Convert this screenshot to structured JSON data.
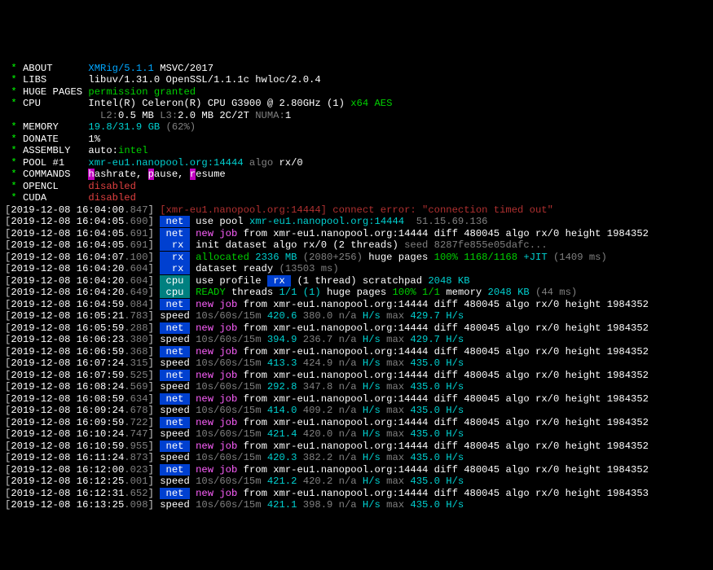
{
  "header": {
    "about": {
      "label": "ABOUT",
      "app": "XMRig/5.1.1",
      "compiler": " MSVC/2017"
    },
    "libs": {
      "label": "LIBS",
      "value": "libuv/1.31.0 OpenSSL/1.1.1c hwloc/2.0.4"
    },
    "huge_pages": {
      "label": "HUGE PAGES",
      "value": "permission granted"
    },
    "cpu": {
      "label": "CPU",
      "name": "Intel(R) Celeron(R) CPU G3900 @ 2.80GHz (1) ",
      "flags": "x64 AES",
      "l2l": "L2:",
      "l2": "0.5 MB",
      "l3l": " L3:",
      "l3": "2.0 MB",
      "core": " 2C/2T",
      "numa": " NUMA:",
      "numav": "1"
    },
    "memory": {
      "label": "MEMORY",
      "value": "19.8/31.9 ",
      "unit": "GB ",
      "pct": "(62%)"
    },
    "donate": {
      "label": "DONATE",
      "value": "1%"
    },
    "assembly": {
      "label": "ASSEMBLY",
      "auto": "auto:",
      "intel": "intel"
    },
    "pool": {
      "label": "POOL #1",
      "value": "xmr-eu1.nanopool.org:14444",
      "algo_l": " algo ",
      "algo": "rx/0"
    },
    "commands": {
      "label": "COMMANDS",
      "h": "h",
      "hr": "ashrate, ",
      "p": "p",
      "pa": "ause, ",
      "r": "r",
      "re": "esume"
    },
    "opencl": {
      "label": "OPENCL",
      "value": "disabled"
    },
    "cuda": {
      "label": "CUDA",
      "value": "disabled"
    }
  },
  "log": [
    {
      "ts": "2019-12-08 16:04:00",
      "ms": ".847",
      "tag": "",
      "txt_red": "[xmr-eu1.nanopool.org:14444] connect error: \"connection timed out\""
    },
    {
      "ts": "2019-12-08 16:04:05",
      "ms": ".690",
      "tag": "net",
      "a": "use pool ",
      "pool": "xmr-eu1.nanopool.org:14444",
      "ip": "  51.15.69.136"
    },
    {
      "ts": "2019-12-08 16:04:05",
      "ms": ".691",
      "tag": "net",
      "a": "new job",
      "b": " from xmr-eu1.nanopool.org:14444 diff ",
      "diff": "480045",
      "c": " algo ",
      "algo": "rx/0",
      "d": " height ",
      "h": "1984352"
    },
    {
      "ts": "2019-12-08 16:04:05",
      "ms": ".691",
      "tag": "rx",
      "a2": "init dataset",
      " b": " algo ",
      "algo": "rx/0",
      "thr": " (2 threads)",
      "seed": " seed 8287fe855e05dafc..."
    },
    {
      "ts": "2019-12-08 16:04:07",
      "ms": ".100",
      "tag": "rx",
      "a2": "allocated",
      "mb": " 2336 MB",
      "g": " (2080+256) ",
      "hp": "huge pages ",
      "ok": "100% 1168/1168",
      "jit": " +JIT",
      "e": " (1409 ms)"
    },
    {
      "ts": "2019-12-08 16:04:20",
      "ms": ".604",
      "tag": "rx",
      "a2": "dataset ready",
      "g2": " (13503 ms)"
    },
    {
      "ts": "2019-12-08 16:04:20",
      "ms": ".604",
      "tag": "cpu",
      "a": "use profile ",
      " prof": " rx ",
      "thr2": " (1 thread)",
      "sp": " scratchpad ",
      "spv": "2048 KB"
    },
    {
      "ts": "2019-12-08 16:04:20",
      "ms": ".649",
      "tag": "cpu",
      "rdy": "READY ",
      "rt": "threads ",
      "tok": "1/1 (1)",
      "hp2": " huge pages ",
      "ok2": "100% 1/1",
      "mem": " memory ",
      "memv": "2048 KB",
      "g3": " (44 ms)"
    },
    {
      "ts": "2019-12-08 16:04:59",
      "ms": ".084",
      "tag": "net",
      "a": "new job",
      "b": " from xmr-eu1.nanopool.org:14444 diff ",
      "diff": "480045",
      "c": " algo ",
      "algo": "rx/0",
      "d": " height ",
      "h": "1984352"
    },
    {
      "ts": "2019-12-08 16:05:21",
      "ms": ".783",
      "tag": "",
      "spd": "speed",
      "sl": " 10s/60s/15m ",
      "v1": "420.6 ",
      "v2": "380.0 ",
      "v3": "n/a ",
      "hs": "H/s ",
      "mx": "max ",
      "mv": "429.7 H/s"
    },
    {
      "ts": "2019-12-08 16:05:59",
      "ms": ".288",
      "tag": "net",
      "a": "new job",
      "b": " from xmr-eu1.nanopool.org:14444 diff ",
      "diff": "480045",
      "c": " algo ",
      "algo": "rx/0",
      "d": " height ",
      "h": "1984352"
    },
    {
      "ts": "2019-12-08 16:06:23",
      "ms": ".380",
      "tag": "",
      "spd": "speed",
      "sl": " 10s/60s/15m ",
      "v1": "394.9 ",
      "v2": "236.7 ",
      "v3": "n/a ",
      "hs": "H/s ",
      "mx": "max ",
      "mv": "429.7 H/s"
    },
    {
      "ts": "2019-12-08 16:06:59",
      "ms": ".368",
      "tag": "net",
      "a": "new job",
      "b": " from xmr-eu1.nanopool.org:14444 diff ",
      "diff": "480045",
      "c": " algo ",
      "algo": "rx/0",
      "d": " height ",
      "h": "1984352"
    },
    {
      "ts": "2019-12-08 16:07:24",
      "ms": ".315",
      "tag": "",
      "spd": "speed",
      "sl": " 10s/60s/15m ",
      "v1": "413.3 ",
      "v2": "424.9 ",
      "v3": "n/a ",
      "hs": "H/s ",
      "mx": "max ",
      "mv": "435.0 H/s"
    },
    {
      "ts": "2019-12-08 16:07:59",
      "ms": ".525",
      "tag": "net",
      "a": "new job",
      "b": " from xmr-eu1.nanopool.org:14444 diff ",
      "diff": "480045",
      "c": " algo ",
      "algo": "rx/0",
      "d": " height ",
      "h": "1984352"
    },
    {
      "ts": "2019-12-08 16:08:24",
      "ms": ".569",
      "tag": "",
      "spd": "speed",
      "sl": " 10s/60s/15m ",
      "v1": "292.8 ",
      "v2": "347.8 ",
      "v3": "n/a ",
      "hs": "H/s ",
      "mx": "max ",
      "mv": "435.0 H/s"
    },
    {
      "ts": "2019-12-08 16:08:59",
      "ms": ".634",
      "tag": "net",
      "a": "new job",
      "b": " from xmr-eu1.nanopool.org:14444 diff ",
      "diff": "480045",
      "c": " algo ",
      "algo": "rx/0",
      "d": " height ",
      "h": "1984352"
    },
    {
      "ts": "2019-12-08 16:09:24",
      "ms": ".678",
      "tag": "",
      "spd": "speed",
      "sl": " 10s/60s/15m ",
      "v1": "414.0 ",
      "v2": "409.2 ",
      "v3": "n/a ",
      "hs": "H/s ",
      "mx": "max ",
      "mv": "435.0 H/s"
    },
    {
      "ts": "2019-12-08 16:09:59",
      "ms": ".722",
      "tag": "net",
      "a": "new job",
      "b": " from xmr-eu1.nanopool.org:14444 diff ",
      "diff": "480045",
      "c": " algo ",
      "algo": "rx/0",
      "d": " height ",
      "h": "1984352"
    },
    {
      "ts": "2019-12-08 16:10:24",
      "ms": ".747",
      "tag": "",
      "spd": "speed",
      "sl": " 10s/60s/15m ",
      "v1": "421.4 ",
      "v2": "420.0 ",
      "v3": "n/a ",
      "hs": "H/s ",
      "mx": "max ",
      "mv": "435.0 H/s"
    },
    {
      "ts": "2019-12-08 16:10:59",
      "ms": ".955",
      "tag": "net",
      "a": "new job",
      "b": " from xmr-eu1.nanopool.org:14444 diff ",
      "diff": "480045",
      "c": " algo ",
      "algo": "rx/0",
      "d": " height ",
      "h": "1984352"
    },
    {
      "ts": "2019-12-08 16:11:24",
      "ms": ".873",
      "tag": "",
      "spd": "speed",
      "sl": " 10s/60s/15m ",
      "v1": "420.3 ",
      "v2": "382.2 ",
      "v3": "n/a ",
      "hs": "H/s ",
      "mx": "max ",
      "mv": "435.0 H/s"
    },
    {
      "ts": "2019-12-08 16:12:00",
      "ms": ".023",
      "tag": "net",
      "a": "new job",
      "b": " from xmr-eu1.nanopool.org:14444 diff ",
      "diff": "480045",
      "c": " algo ",
      "algo": "rx/0",
      "d": " height ",
      "h": "1984352"
    },
    {
      "ts": "2019-12-08 16:12:25",
      "ms": ".001",
      "tag": "",
      "spd": "speed",
      "sl": " 10s/60s/15m ",
      "v1": "421.2 ",
      "v2": "420.2 ",
      "v3": "n/a ",
      "hs": "H/s ",
      "mx": "max ",
      "mv": "435.0 H/s"
    },
    {
      "ts": "2019-12-08 16:12:31",
      "ms": ".652",
      "tag": "net",
      "a": "new job",
      "b": " from xmr-eu1.nanopool.org:14444 diff ",
      "diff": "480045",
      "c": " algo ",
      "algo": "rx/0",
      "d": " height ",
      "h": "1984353"
    },
    {
      "ts": "2019-12-08 16:13:25",
      "ms": ".098",
      "tag": "",
      "spd": "speed",
      "sl": " 10s/60s/15m ",
      "v1": "421.1 ",
      "v2": "398.9 ",
      "v3": "n/a ",
      "hs": "H/s ",
      "mx": "max ",
      "mv": "435.0 H/s"
    }
  ]
}
